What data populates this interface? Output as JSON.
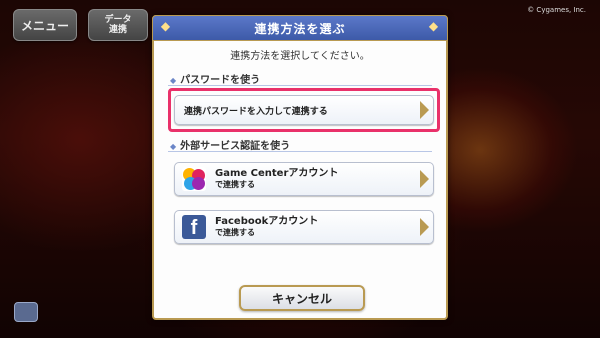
{
  "hud": {
    "menu_label": "メニュー",
    "data_label_line1": "データ",
    "data_label_line2": "連携",
    "copyright": "© Cygames, Inc."
  },
  "dialog": {
    "title": "連携方法を選ぶ",
    "subtitle": "連携方法を選択してください。",
    "section_password": "パスワードを使う",
    "password_option": "連携パスワードを入力して連携する",
    "section_external": "外部サービス認証を使う",
    "gamecenter_line1": "Game Centerアカウント",
    "gamecenter_line2": "で連携する",
    "facebook_line1": "Facebookアカウント",
    "facebook_line2": "で連携する",
    "cancel_label": "キャンセル"
  },
  "colors": {
    "title_bar": "#3d5aa8",
    "highlight": "#e9316a",
    "gold_border": "#b99a52",
    "facebook_blue": "#3b5998"
  },
  "icons": {
    "title_ornament": "diamond-icon",
    "section_marker": "diamond-icon",
    "option_arrow": "arrow-right-icon",
    "gamecenter": "game-center-icon",
    "facebook": "facebook-icon"
  }
}
